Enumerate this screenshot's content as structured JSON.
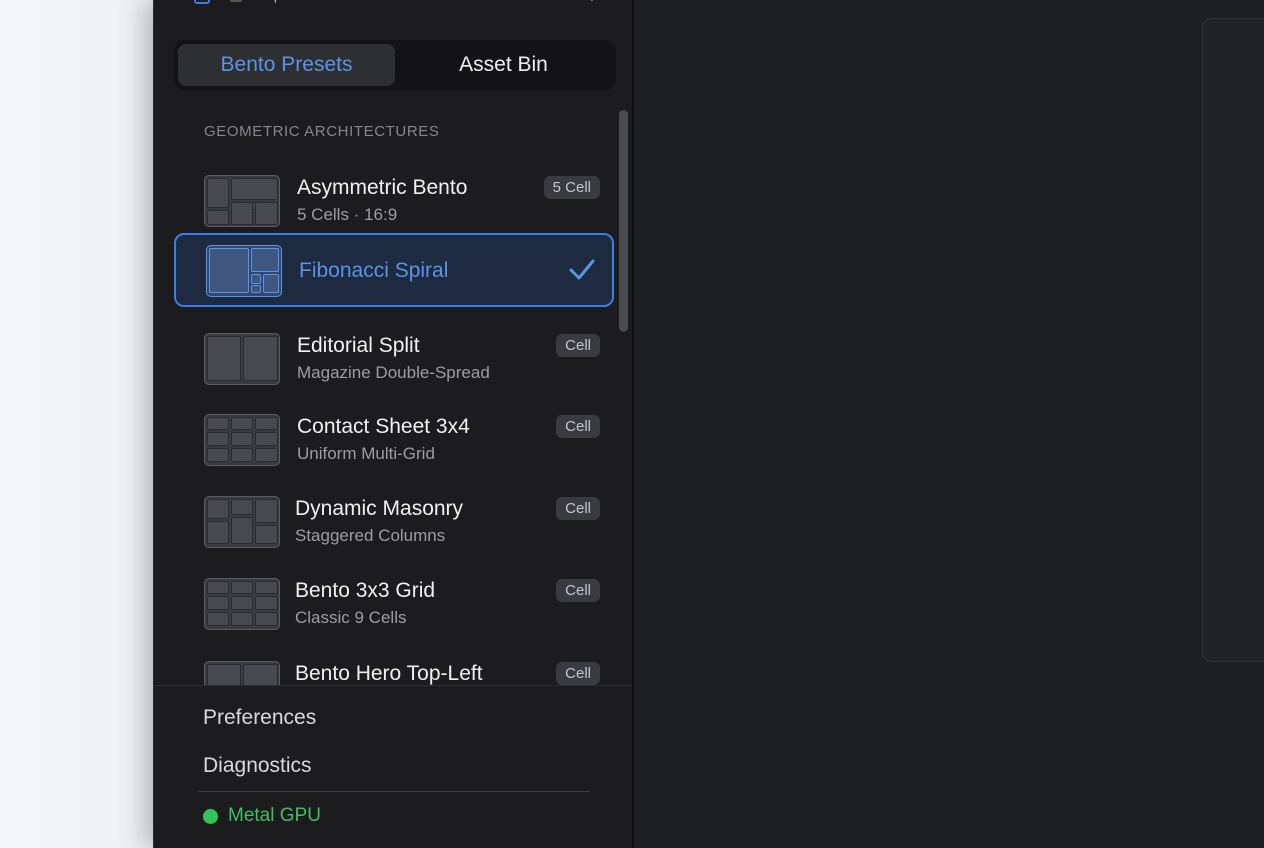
{
  "colors": {
    "accent": "#3b7ee8",
    "accent_text": "#5b93e6",
    "status_green": "#36c25a"
  },
  "toolbar_top": {
    "partial_text": "· ·, ·"
  },
  "tabs": [
    {
      "label": "Bento Presets",
      "active": true
    },
    {
      "label": "Asset Bin",
      "active": false
    }
  ],
  "section": {
    "header": "GEOMETRIC ARCHITECTURES"
  },
  "presets": [
    {
      "title": "Asymmetric Bento",
      "subtitle": "5 Cells · 16:9",
      "badge": "5 Cell",
      "icon": "asymmetric-layout-icon"
    },
    {
      "title": "Fibonacci Spiral",
      "subtitle": "",
      "badge": "",
      "selected": true,
      "icon": "fibonacci-layout-icon"
    },
    {
      "title": "Editorial Split",
      "subtitle": "Magazine Double-Spread",
      "badge": "Cell",
      "icon": "split-layout-icon"
    },
    {
      "title": "Contact Sheet 3x4",
      "subtitle": "Uniform Multi-Grid",
      "badge": "Cell",
      "icon": "grid-3x4-icon"
    },
    {
      "title": "Dynamic Masonry",
      "subtitle": "Staggered Columns",
      "badge": "Cell",
      "icon": "masonry-layout-icon"
    },
    {
      "title": "Bento 3x3 Grid",
      "subtitle": "Classic 9 Cells",
      "badge": "Cell",
      "icon": "grid-3x3-icon"
    },
    {
      "title": "Bento Hero Top-Left",
      "subtitle": "",
      "badge": "Cell",
      "icon": "hero-layout-icon"
    }
  ],
  "footer": {
    "preferences": "Preferences",
    "diagnostics": "Diagnostics",
    "status": "Metal GPU"
  }
}
